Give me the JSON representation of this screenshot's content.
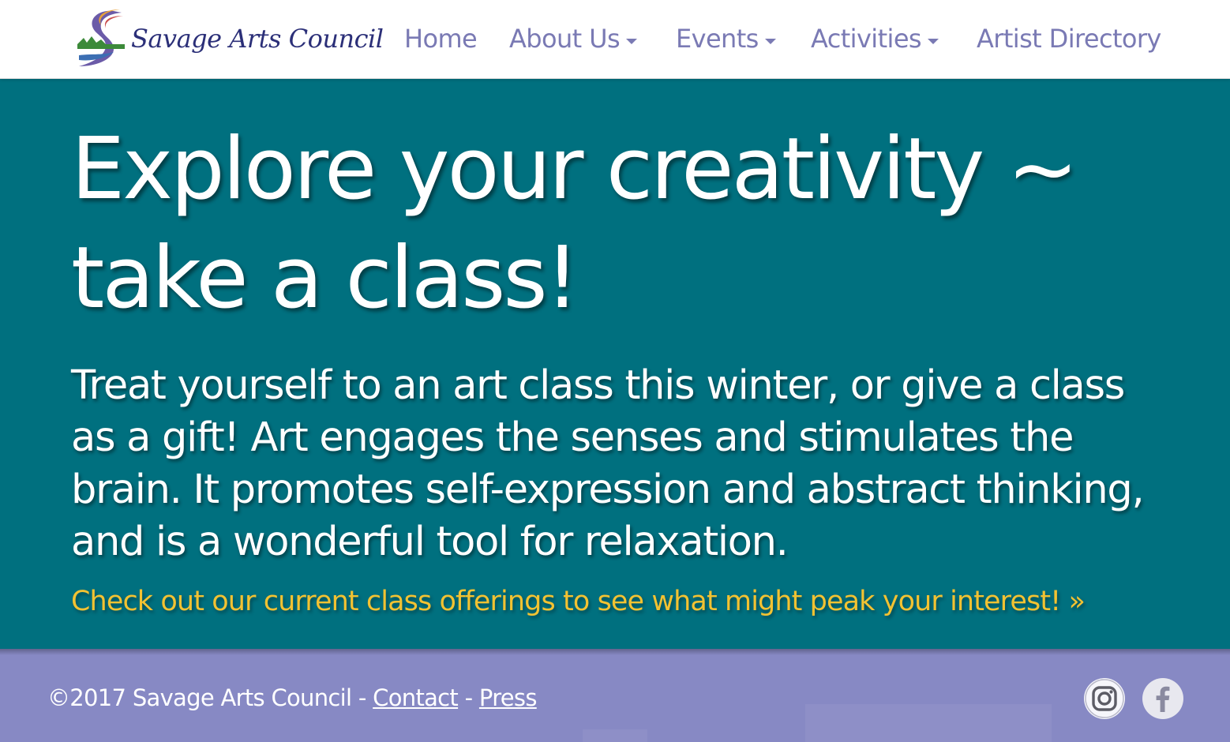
{
  "brand": {
    "name": "Savage Arts Council",
    "colors": {
      "nav_text": "#7a7ab4",
      "logo_text": "#2b2f78",
      "hero_bg": "#00707f",
      "hero_link": "#f2c232",
      "footer_bg": "#8789c4"
    }
  },
  "nav": {
    "items": [
      {
        "label": "Home",
        "has_dropdown": false
      },
      {
        "label": "About Us",
        "has_dropdown": true
      },
      {
        "label": "Events",
        "has_dropdown": true
      },
      {
        "label": "Activities",
        "has_dropdown": true
      },
      {
        "label": "Artist Directory",
        "has_dropdown": false
      }
    ]
  },
  "hero": {
    "title": "Explore your creativity ~ take a class!",
    "body": "Treat yourself to an art class this winter, or give a class as a gift! Art engages the senses and stimulates the brain. It promotes self-expression and abstract thinking, and is a wonderful tool for relaxation.",
    "link_label": "Check out our current class offerings to see what might peak your interest! »"
  },
  "footer": {
    "copyright": "©2017 Savage Arts Council - ",
    "contact_label": "Contact",
    "separator": " - ",
    "press_label": "Press",
    "social": [
      {
        "icon": "instagram-icon"
      },
      {
        "icon": "facebook-icon"
      }
    ]
  }
}
